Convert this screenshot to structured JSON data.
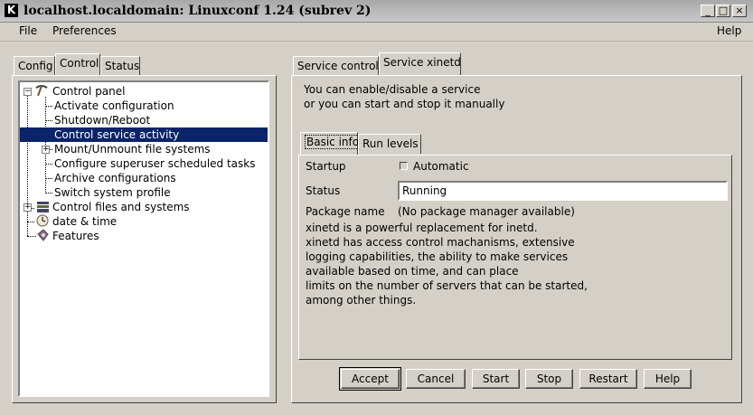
{
  "window": {
    "title": "localhost.localdomain: Linuxconf 1.24 (subrev 2)",
    "app_icon": "K",
    "minimize_glyph": "_",
    "maximize_glyph": "□",
    "close_glyph": "×"
  },
  "menu": {
    "file": "File",
    "preferences": "Preferences",
    "help": "Help"
  },
  "left_tabs": [
    "Config",
    "Control",
    "Status"
  ],
  "tree": {
    "items": [
      {
        "label": "Control panel",
        "icon": "pickaxe-icon"
      },
      {
        "label": "Activate configuration"
      },
      {
        "label": "Shutdown/Reboot"
      },
      {
        "label": "Control service activity"
      },
      {
        "label": "Mount/Unmount file systems"
      },
      {
        "label": "Configure superuser scheduled tasks"
      },
      {
        "label": "Archive configurations"
      },
      {
        "label": "Switch system profile"
      },
      {
        "label": "Control files and systems",
        "icon": "files-icon"
      },
      {
        "label": "date & time",
        "icon": "clock-icon"
      },
      {
        "label": "Features",
        "icon": "features-icon"
      }
    ]
  },
  "right_tabs": [
    "Service control",
    "Service xinetd"
  ],
  "description": [
    "You can enable/disable a service",
    "or you can start and stop it manually"
  ],
  "inner_tabs": [
    "Basic info",
    "Run levels"
  ],
  "form": {
    "startup_label": "Startup",
    "automatic_label": "Automatic",
    "automatic_checked": false,
    "status_label": "Status",
    "status_value": "Running",
    "package_label": "Package name",
    "package_value": "(No package manager available)",
    "info_lines": [
      "xinetd is a powerful replacement for inetd.",
      "xinetd has access control machanisms, extensive",
      "logging capabilities, the ability to make services",
      "available based on time, and can place",
      "limits on the number of servers that can be started,",
      "among other things."
    ]
  },
  "buttons": {
    "accept": "Accept",
    "cancel": "Cancel",
    "start": "Start",
    "stop": "Stop",
    "restart": "Restart",
    "help": "Help"
  },
  "colors": {
    "selection": "#0a246a",
    "background": "#d4d0c8"
  }
}
